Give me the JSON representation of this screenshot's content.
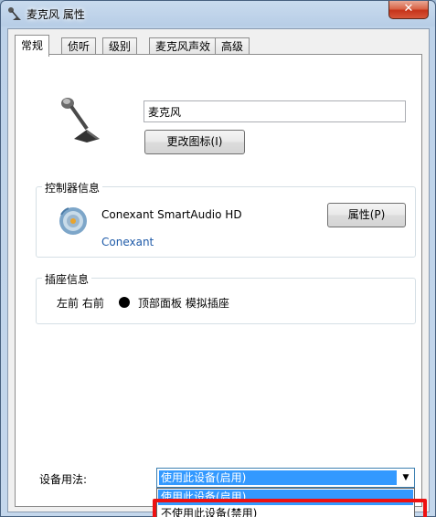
{
  "window": {
    "title": "麦克风 属性",
    "close_label": "✕"
  },
  "tabs": [
    {
      "label": "常规",
      "active": true
    },
    {
      "label": "侦听",
      "active": false
    },
    {
      "label": "级别",
      "active": false
    },
    {
      "label": "麦克风声效",
      "active": false
    },
    {
      "label": "高级",
      "active": false
    }
  ],
  "general": {
    "device_name": "麦克风",
    "change_icon_label": "更改图标(I)",
    "controller": {
      "title": "控制器信息",
      "name": "Conexant SmartAudio HD",
      "vendor": "Conexant",
      "properties_label": "属性(P)"
    },
    "jack": {
      "title": "插座信息",
      "position": "左前 右前",
      "description": "顶部面板 模拟插座"
    },
    "usage": {
      "label": "设备用法:",
      "selected": "使用此设备(启用)",
      "options": [
        "使用此设备(启用)",
        "不使用此设备(禁用)"
      ]
    }
  },
  "colors": {
    "selection": "#3399ff",
    "highlight_box": "#ee1111",
    "link": "#1e5aa8"
  }
}
